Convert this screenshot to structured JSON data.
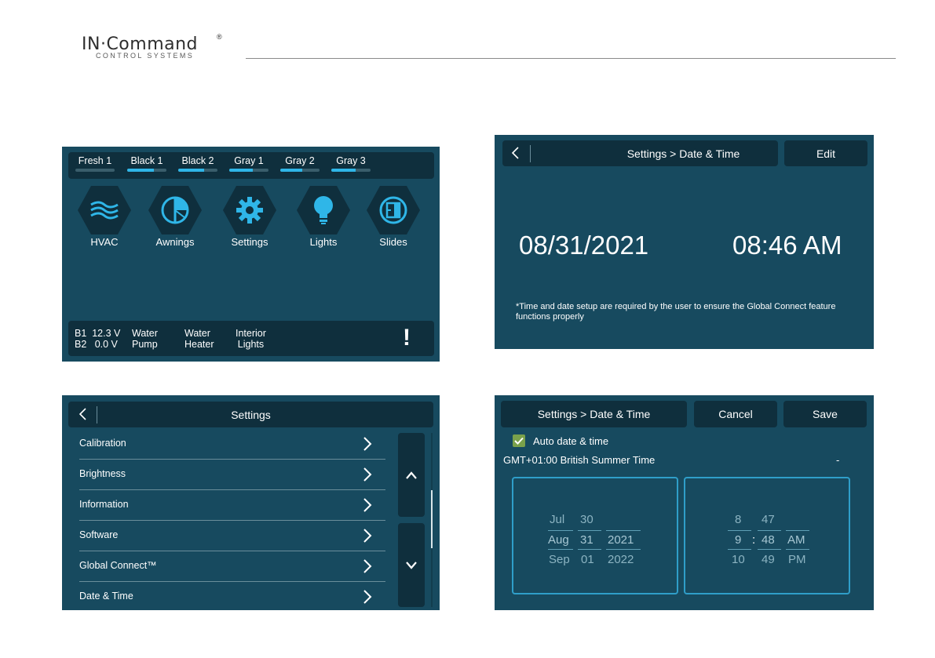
{
  "brand": {
    "name": "IN·Command",
    "reg": "®",
    "subtitle": "CONTROL SYSTEMS"
  },
  "home": {
    "tanks": [
      {
        "label": "Fresh 1",
        "level": 0.0
      },
      {
        "label": "Black 1",
        "level": 0.68
      },
      {
        "label": "Black 2",
        "level": 0.65
      },
      {
        "label": "Gray 1",
        "level": 0.6
      },
      {
        "label": "Gray 2",
        "level": 0.55
      },
      {
        "label": "Gray 3",
        "level": 0.62
      }
    ],
    "tiles": [
      {
        "label": "HVAC",
        "icon": "hvac-icon"
      },
      {
        "label": "Awnings",
        "icon": "awnings-icon"
      },
      {
        "label": "Settings",
        "icon": "gear-icon"
      },
      {
        "label": "Lights",
        "icon": "lightbulb-icon"
      },
      {
        "label": "Slides",
        "icon": "slides-icon"
      }
    ],
    "battery": {
      "b1": "B1  12.3 V",
      "b2": "B2   0.0 V"
    },
    "quick": [
      {
        "line1": "Water",
        "line2": "Pump"
      },
      {
        "line1": "Water",
        "line2": "Heater"
      },
      {
        "line1": "Interior",
        "line2": "Lights"
      }
    ],
    "alert": "!"
  },
  "datetime_view": {
    "title": "Settings > Date & Time",
    "edit_label": "Edit",
    "date": "08/31/2021",
    "time": "08:46 AM",
    "note": "*Time and date setup are required by the user to ensure the Global Connect feature functions properly"
  },
  "settings": {
    "title": "Settings",
    "items": [
      "Calibration",
      "Brightness",
      "Information",
      "Software",
      "Global Connect™",
      "Date & Time"
    ]
  },
  "datetime_edit": {
    "title": "Settings > Date & Time",
    "cancel_label": "Cancel",
    "save_label": "Save",
    "auto_label": "Auto date & time",
    "auto_checked": true,
    "timezone": "GMT+01:00 British Summer Time",
    "tz_dash": "-",
    "date_picker": {
      "months": [
        "Jul",
        "Aug",
        "Sep"
      ],
      "days": [
        "30",
        "31",
        "01"
      ],
      "years": [
        "2021",
        "2022"
      ]
    },
    "time_picker": {
      "hours": [
        "8",
        "9",
        "10"
      ],
      "minutes": [
        "47",
        "48",
        "49"
      ],
      "separator": ":",
      "ampm": [
        "AM",
        "PM"
      ]
    }
  }
}
